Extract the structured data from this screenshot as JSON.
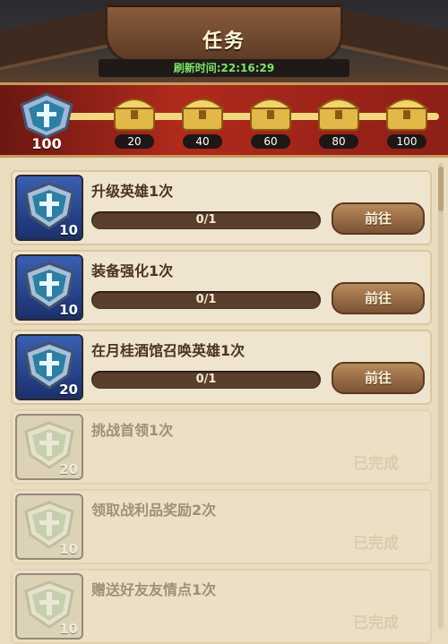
{
  "header": {
    "title": "任务",
    "refresh_label": "刷新时间:22:16:29"
  },
  "progress": {
    "total": "100",
    "fraction": 1.0,
    "chests": [
      {
        "label": "20"
      },
      {
        "label": "40"
      },
      {
        "label": "60"
      },
      {
        "label": "80"
      },
      {
        "label": "100"
      }
    ]
  },
  "tasks": [
    {
      "name": "升级英雄1次",
      "reward": "10",
      "progress": "0/1",
      "button": "前往"
    },
    {
      "name": "装备强化1次",
      "reward": "10",
      "progress": "0/1",
      "button": "前往"
    },
    {
      "name": "在月桂酒馆召唤英雄1次",
      "reward": "20",
      "progress": "0/1",
      "button": "前往"
    },
    {
      "name": "挑战首领1次",
      "reward": "20",
      "status": "已完成"
    },
    {
      "name": "领取战利品奖励2次",
      "reward": "10",
      "status": "已完成"
    },
    {
      "name": "赠送好友友情点1次",
      "reward": "10",
      "status": "已完成"
    }
  ],
  "colors": {
    "band_red": "#b02a1c",
    "refresh_green": "#7fe36b",
    "shield_blue": "#3a5fb0"
  }
}
